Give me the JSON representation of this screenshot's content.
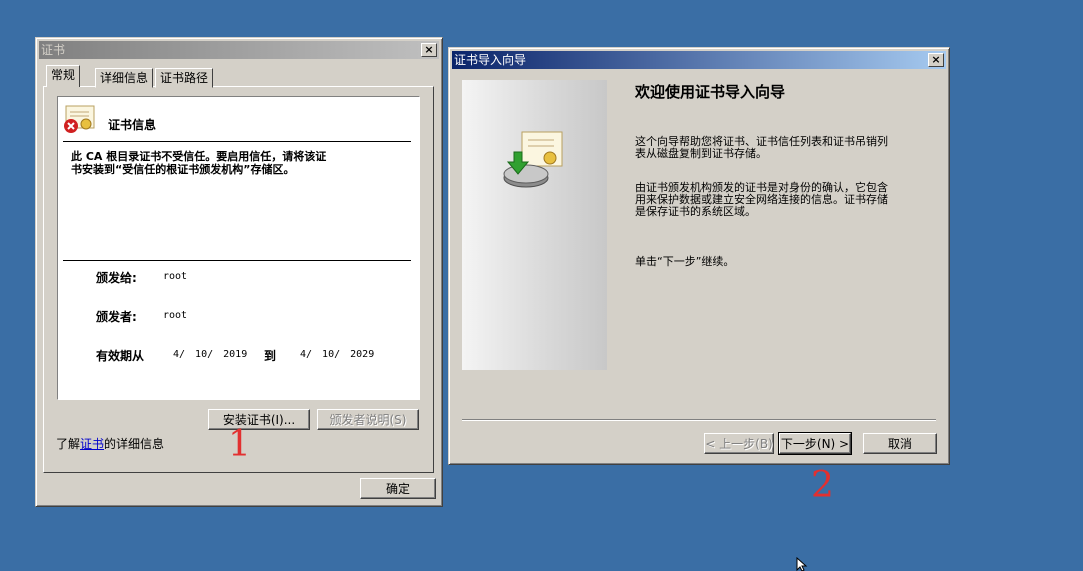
{
  "cert_window": {
    "title": "证书",
    "close_label": "×",
    "tabs": [
      "常规",
      "详细信息",
      "证书路径"
    ],
    "info_title": "证书信息",
    "warning_line1": "此 CA 根目录证书不受信任。要启用信任，请将该证",
    "warning_line2": "书安装到“受信任的根证书颁发机构”存储区。",
    "issued_to_label": "颁发给:",
    "issued_to_value": "root",
    "issued_by_label": "颁发者:",
    "issued_by_value": "root",
    "valid_label": "有效期从",
    "valid_from": "4/ 10/ 2019",
    "valid_to_label": "到",
    "valid_to": "4/ 10/ 2029",
    "install_button": "安装证书(I)...",
    "issuer_statement_button": "颁发者说明(S)",
    "learn_more_prefix": "了解",
    "learn_more_link": "证书",
    "learn_more_suffix": "的详细信息",
    "ok_button": "确定"
  },
  "wizard_window": {
    "title": "证书导入向导",
    "close_label": "×",
    "heading": "欢迎使用证书导入向导",
    "para1_line1": "这个向导帮助您将证书、证书信任列表和证书吊销列",
    "para1_line2": "表从磁盘复制到证书存储。",
    "para2_line1": "由证书颁发机构颁发的证书是对身份的确认，它包含",
    "para2_line2": "用来保护数据或建立安全网络连接的信息。证书存储",
    "para2_line3": "是保存证书的系统区域。",
    "para3": "单击“下一步”继续。",
    "back_button": "< 上一步(B)",
    "next_button": "下一步(N) >",
    "cancel_button": "取消"
  },
  "annotations": {
    "mark1": "1",
    "mark2": "2"
  },
  "colors": {
    "desktop": "#3a6ea5",
    "annotation": "#e23030",
    "link": "#0000cc"
  }
}
